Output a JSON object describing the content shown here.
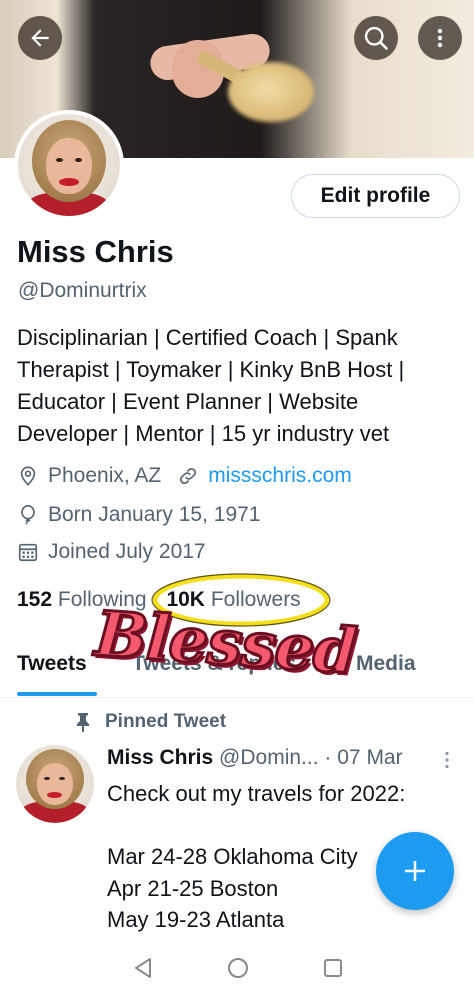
{
  "header": {
    "back_icon": "arrow-left-icon",
    "search_icon": "search-icon",
    "more_icon": "more-vertical-icon"
  },
  "profile": {
    "name": "Miss Chris",
    "handle": "@Dominurtrix",
    "edit_label": "Edit profile",
    "bio": "Disciplinarian | Certified Coach | Spank Therapist | Toymaker | Kinky BnB Host | Educator | Event Planner | Website Developer | Mentor | 15 yr industry vet",
    "location": "Phoenix, AZ",
    "website": "missschris.com",
    "birthday": "Born January 15, 1971",
    "joined": "Joined July 2017",
    "following_count": "152",
    "following_label": "Following",
    "followers_count": "10K",
    "followers_label": "Followers"
  },
  "tabs": [
    {
      "label": "Tweets"
    },
    {
      "label": "Tweets & replies"
    },
    {
      "label": "Media"
    }
  ],
  "pinned_tweet": {
    "pinned_label": "Pinned Tweet",
    "author_name": "Miss Chris",
    "author_handle": "@Domin...",
    "separator": "·",
    "date": "07 Mar",
    "text": "Check out my travels for 2022:\n\nMar 24-28 Oklahoma City\nApr 21-25 Boston\nMay 19-23 Atlanta"
  },
  "overlay": {
    "sticker_text": "Blessed"
  },
  "colors": {
    "accent": "#1d9bf0",
    "text": "#0f1419",
    "muted": "#536471",
    "highlight": "#f4df1a",
    "sticker": "#f4596e"
  }
}
